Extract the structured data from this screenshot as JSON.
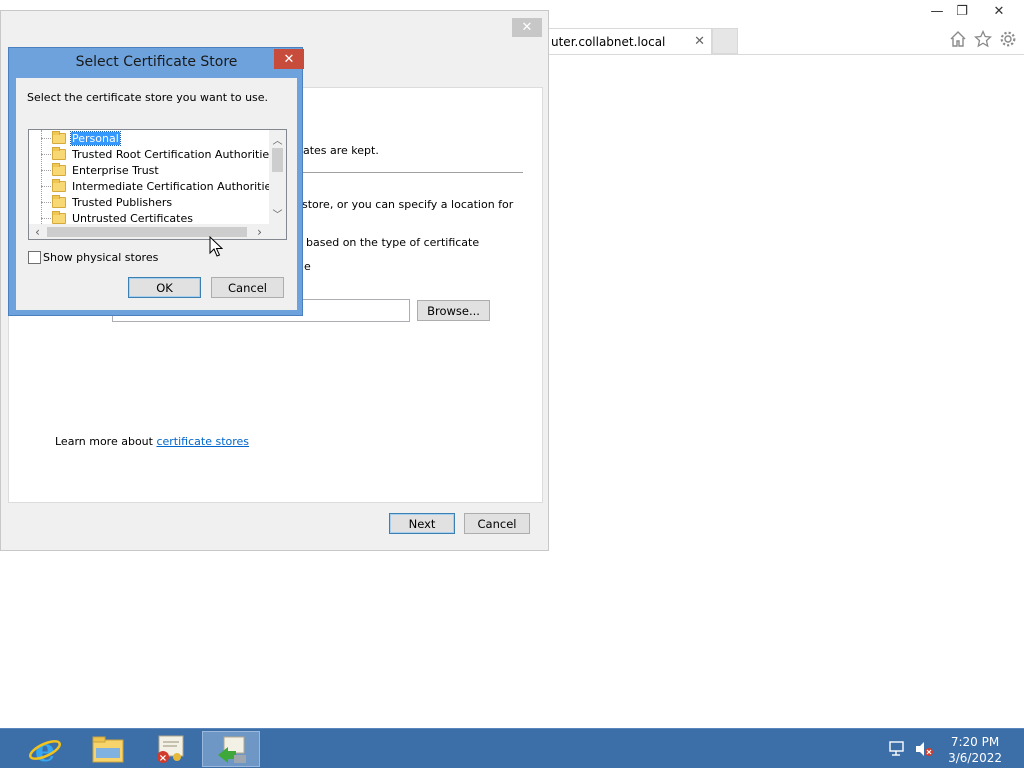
{
  "browser": {
    "tab_title": "uter.collabnet.local",
    "tab_close": "✕",
    "minimize": "—",
    "restore": "❐",
    "close": "✕",
    "home_icon": "home-icon",
    "favorites_icon": "star-icon",
    "settings_icon": "gear-icon"
  },
  "wizard": {
    "close": "✕",
    "text_kept": "ficates are kept.",
    "text_store": "store, or you can specify a location for",
    "text_type": "based on the type of certificate",
    "text_e": "e",
    "browse_label": "Browse...",
    "learn_more_prefix": "Learn more about ",
    "learn_more_link": "certificate stores",
    "next_label": "Next",
    "cancel_label": "Cancel"
  },
  "dialog": {
    "title": "Select Certificate Store",
    "close": "✕",
    "prompt": "Select the certificate store you want to use.",
    "stores": [
      "Personal",
      "Trusted Root Certification Authorities",
      "Enterprise Trust",
      "Intermediate Certification Authorities",
      "Trusted Publishers",
      "Untrusted Certificates"
    ],
    "show_physical_label": "Show physical stores",
    "ok_label": "OK",
    "cancel_label": "Cancel"
  },
  "taskbar": {
    "apps": [
      "internet-explorer-icon",
      "file-explorer-icon",
      "certificate-manager-icon",
      "certificate-import-wizard-icon"
    ],
    "time": "7:20 PM",
    "date": "3/6/2022"
  }
}
